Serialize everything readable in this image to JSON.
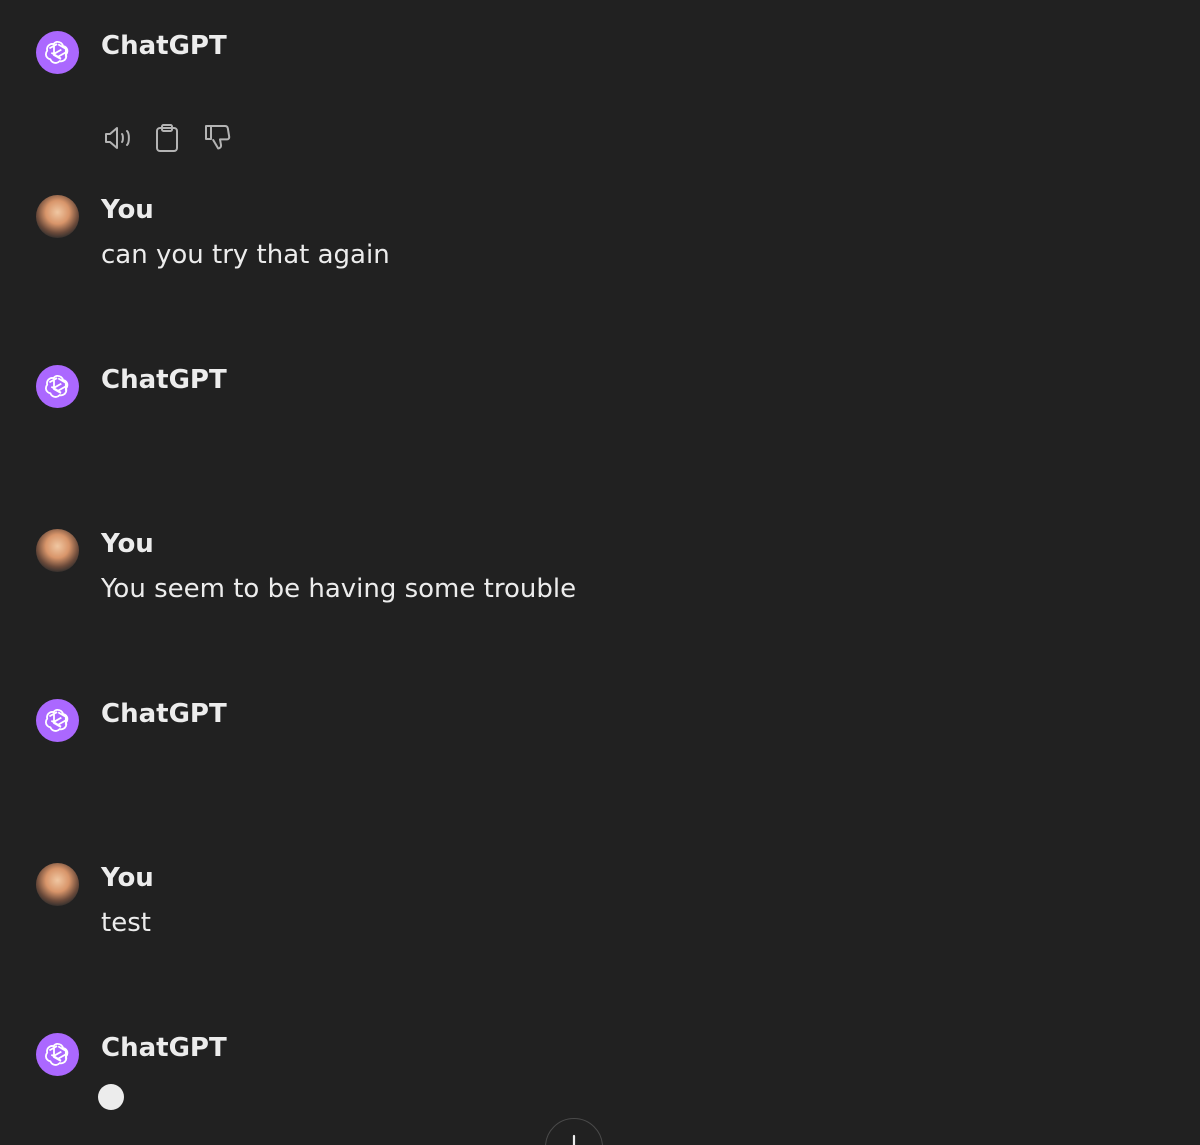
{
  "messages": [
    {
      "role": "assistant",
      "author": "ChatGPT",
      "text": "",
      "avatar_icon": "openai-logo-icon"
    },
    {
      "role": "user",
      "author": "You",
      "text": "can you try that again",
      "avatar_icon": "user-avatar"
    },
    {
      "role": "assistant",
      "author": "ChatGPT",
      "text": "",
      "avatar_icon": "openai-logo-icon"
    },
    {
      "role": "user",
      "author": "You",
      "text": "You seem to be having some trouble",
      "avatar_icon": "user-avatar"
    },
    {
      "role": "assistant",
      "author": "ChatGPT",
      "text": "",
      "avatar_icon": "openai-logo-icon"
    },
    {
      "role": "user",
      "author": "You",
      "text": "test",
      "avatar_icon": "user-avatar"
    },
    {
      "role": "assistant",
      "author": "ChatGPT",
      "text": "",
      "avatar_icon": "openai-logo-icon",
      "streaming": true
    }
  ],
  "message_actions": [
    "speaker-icon",
    "clipboard-icon",
    "thumbs-down-icon"
  ],
  "scroll_button_icon": "arrow-down-icon",
  "colors": {
    "background": "#212121",
    "text": "#ececec",
    "assistant_avatar": "#ab68ff",
    "icon": "#b4b4b4"
  }
}
